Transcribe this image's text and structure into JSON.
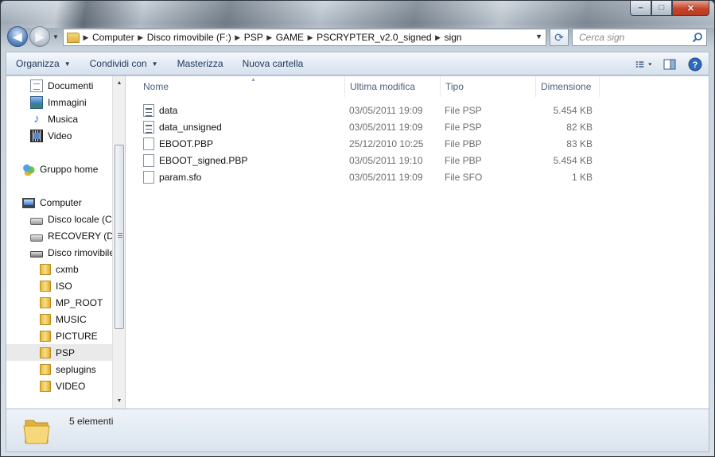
{
  "window": {
    "minimize_glyph": "–",
    "maximize_glyph": "□",
    "close_glyph": "✕"
  },
  "nav": {
    "back_glyph": "◀",
    "forward_glyph": "▶"
  },
  "address": {
    "crumbs": [
      "Computer",
      "Disco rimovibile (F:)",
      "PSP",
      "GAME",
      "PSCRYPTER_v2.0_signed",
      "sign"
    ]
  },
  "search": {
    "placeholder": "Cerca sign"
  },
  "toolbar": {
    "organizza": "Organizza",
    "condividi": "Condividi con",
    "masterizza": "Masterizza",
    "nuova_cartella": "Nuova cartella"
  },
  "sidebar": {
    "items": [
      {
        "label": "Documenti",
        "icon": "documents-icon"
      },
      {
        "label": "Immagini",
        "icon": "pictures-icon"
      },
      {
        "label": "Musica",
        "icon": "music-icon"
      },
      {
        "label": "Video",
        "icon": "video-icon"
      },
      {
        "label": "Gruppo home",
        "icon": "homegroup-icon"
      },
      {
        "label": "Computer",
        "icon": "computer-icon"
      },
      {
        "label": "Disco locale (C:)",
        "icon": "local-disk-icon"
      },
      {
        "label": "RECOVERY (D:)",
        "icon": "drive-icon"
      },
      {
        "label": "Disco rimovibile (F:)",
        "icon": "removable-drive-icon"
      },
      {
        "label": "cxmb",
        "icon": "folder-icon"
      },
      {
        "label": "ISO",
        "icon": "folder-icon"
      },
      {
        "label": "MP_ROOT",
        "icon": "folder-icon"
      },
      {
        "label": "MUSIC",
        "icon": "folder-icon"
      },
      {
        "label": "PICTURE",
        "icon": "folder-icon"
      },
      {
        "label": "PSP",
        "icon": "folder-icon",
        "selected": true
      },
      {
        "label": "seplugins",
        "icon": "folder-icon"
      },
      {
        "label": "VIDEO",
        "icon": "folder-icon"
      }
    ]
  },
  "columns": {
    "name": "Nome",
    "date": "Ultima modifica",
    "type": "Tipo",
    "size": "Dimensione"
  },
  "files": [
    {
      "name": "data",
      "date": "03/05/2011 19:09",
      "type": "File PSP",
      "size": "5.454 KB"
    },
    {
      "name": "data_unsigned",
      "date": "03/05/2011 19:09",
      "type": "File PSP",
      "size": "82 KB"
    },
    {
      "name": "EBOOT.PBP",
      "date": "25/12/2010 10:25",
      "type": "File PBP",
      "size": "83 KB"
    },
    {
      "name": "EBOOT_signed.PBP",
      "date": "03/05/2011 19:10",
      "type": "File PBP",
      "size": "5.454 KB"
    },
    {
      "name": "param.sfo",
      "date": "03/05/2011 19:09",
      "type": "File SFO",
      "size": "1 KB"
    }
  ],
  "status": {
    "count": "5 elementi"
  },
  "colors": {
    "toolbar_text": "#1e395b",
    "header_text": "#4c607a",
    "selection": "#eaeaea"
  }
}
